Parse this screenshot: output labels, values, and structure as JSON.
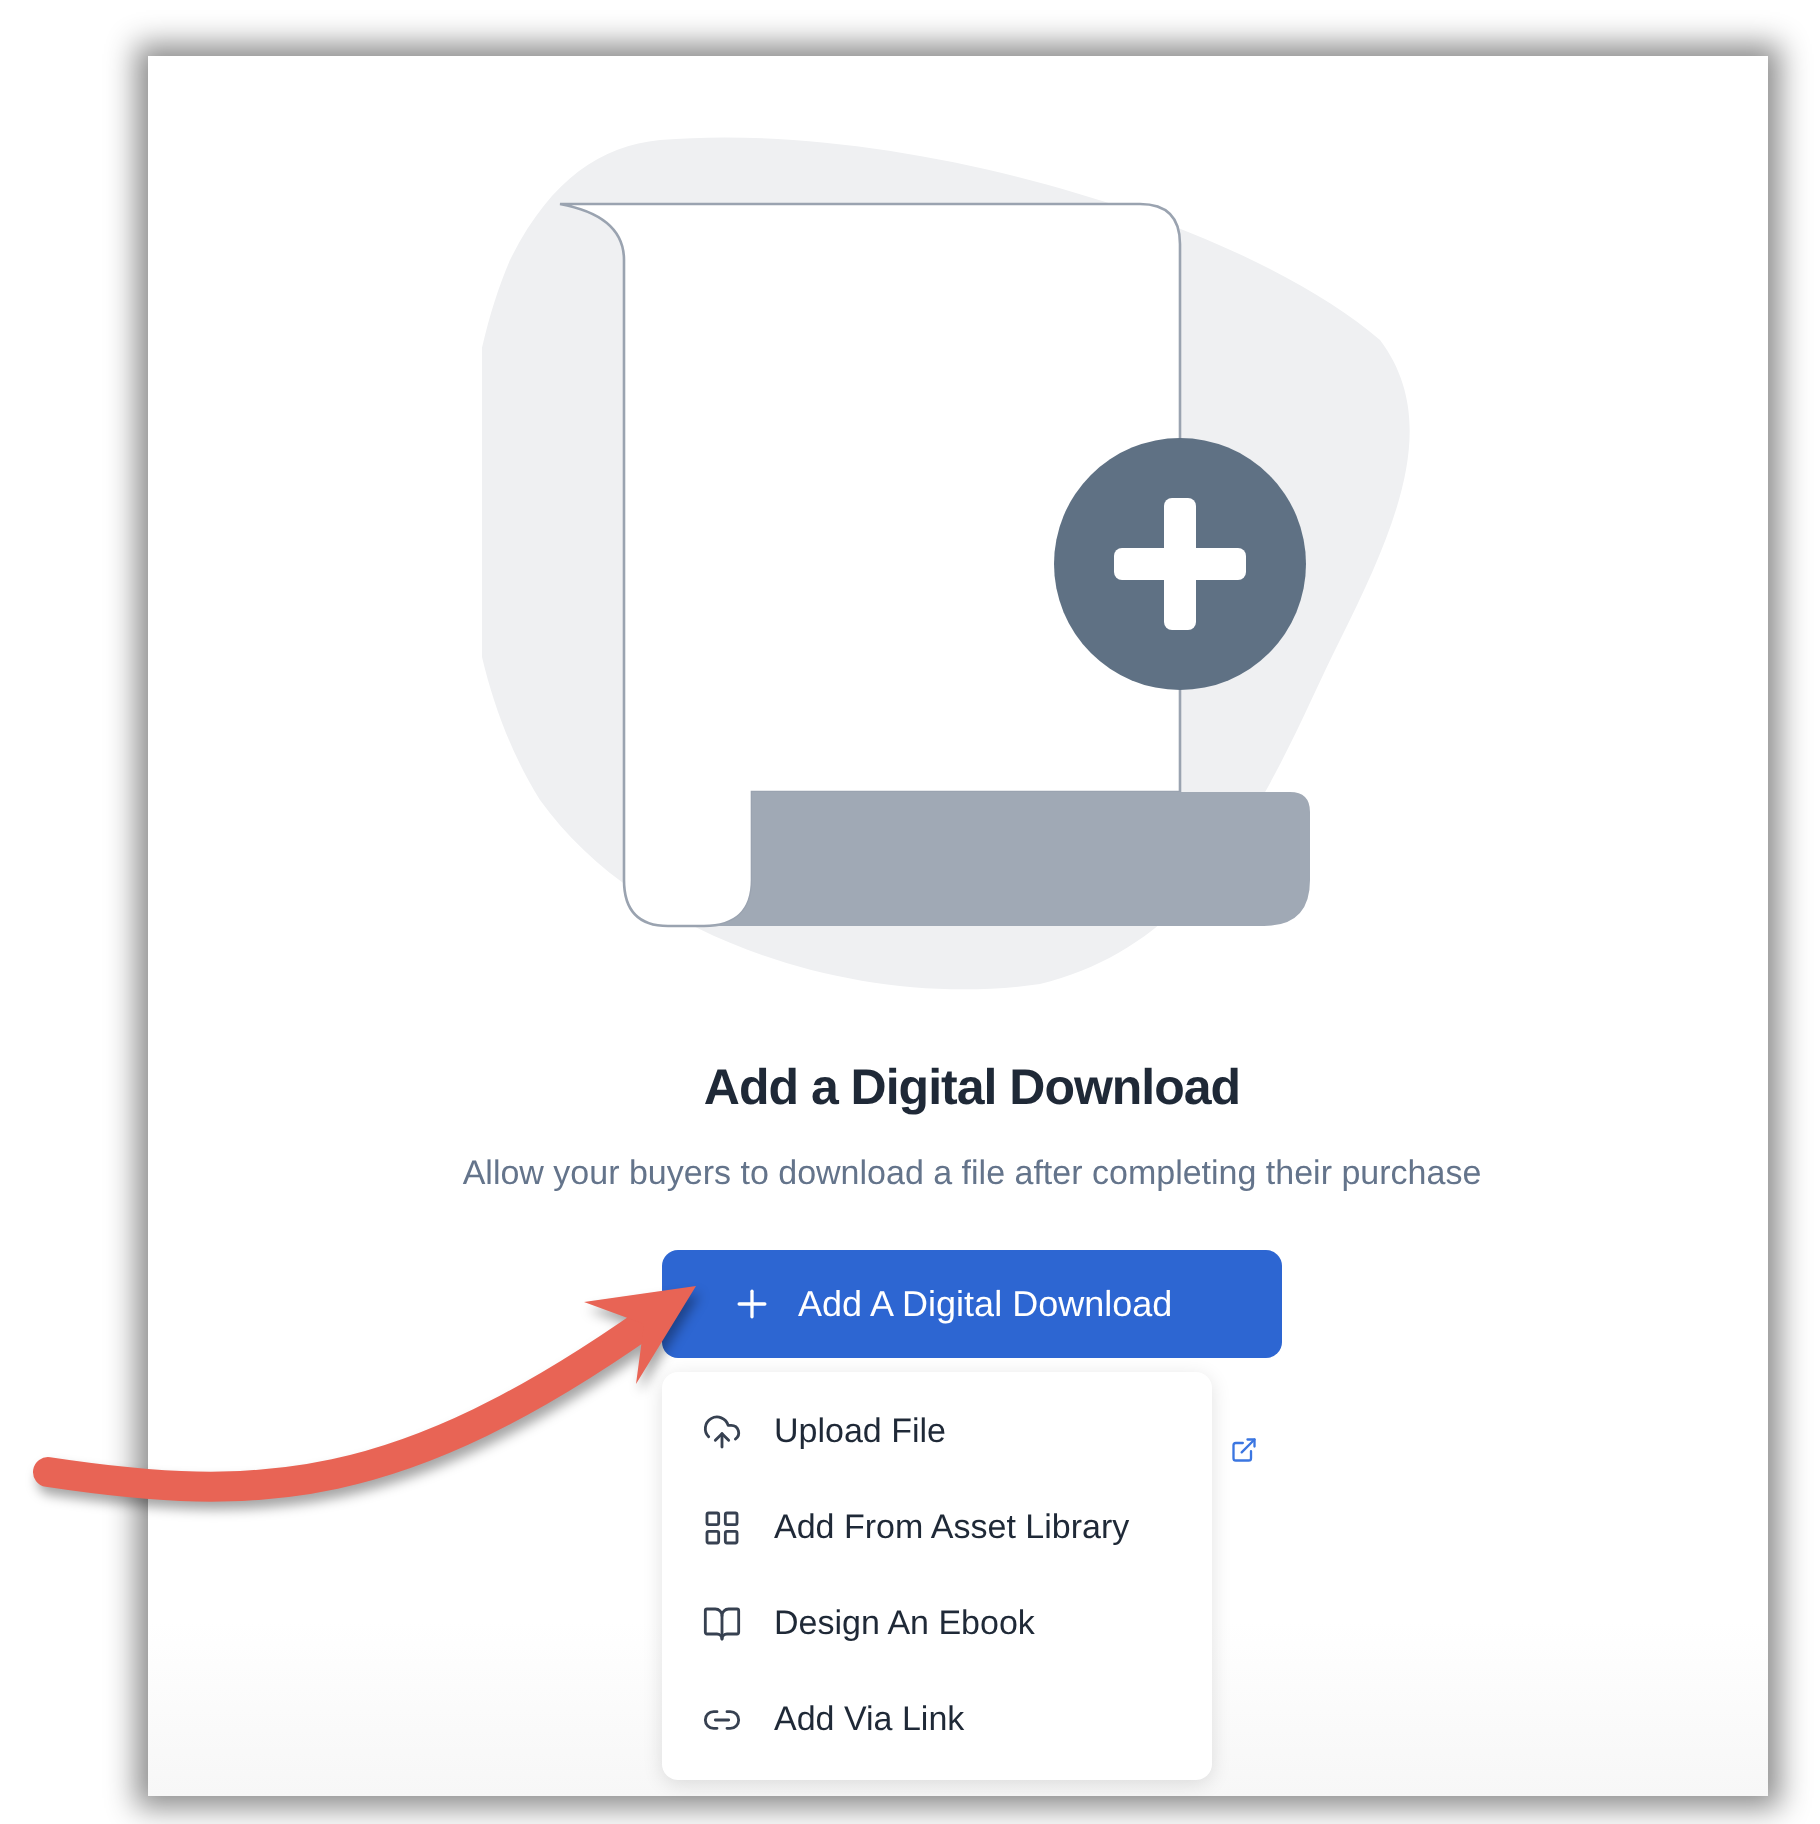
{
  "empty_state": {
    "title": "Add a Digital Download",
    "description": "Allow your buyers to download a file after completing their purchase"
  },
  "add_button": {
    "label": "Add A Digital Download",
    "expanded": true
  },
  "menu": [
    {
      "label": "Upload File",
      "kind": "upload"
    },
    {
      "label": "Add From Asset Library",
      "kind": "library"
    },
    {
      "label": "Design An Ebook",
      "kind": "ebook"
    },
    {
      "label": "Add Via Link",
      "kind": "link"
    }
  ]
}
